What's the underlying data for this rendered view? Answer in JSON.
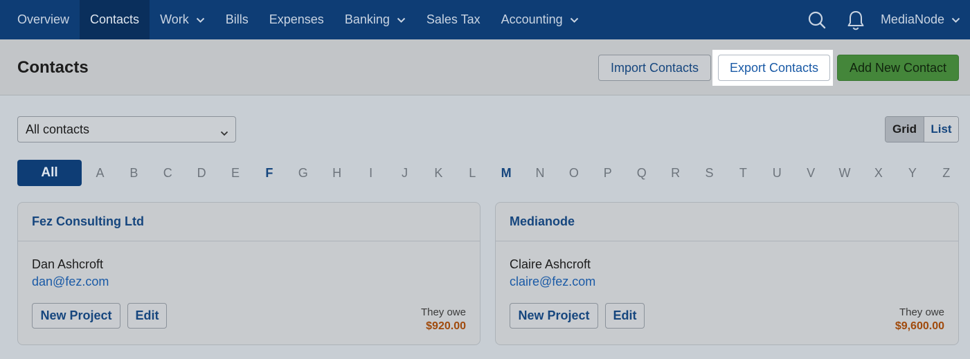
{
  "nav": {
    "items": [
      {
        "label": "Overview",
        "dropdown": false
      },
      {
        "label": "Contacts",
        "dropdown": false,
        "active": true
      },
      {
        "label": "Work",
        "dropdown": true
      },
      {
        "label": "Bills",
        "dropdown": false
      },
      {
        "label": "Expenses",
        "dropdown": false
      },
      {
        "label": "Banking",
        "dropdown": true
      },
      {
        "label": "Sales Tax",
        "dropdown": false
      },
      {
        "label": "Accounting",
        "dropdown": true
      }
    ],
    "account": "MediaNode",
    "icons": [
      "search-icon",
      "bell-icon"
    ]
  },
  "header": {
    "title": "Contacts",
    "import_label": "Import Contacts",
    "export_label": "Export Contacts",
    "add_label": "Add New Contact"
  },
  "filter": {
    "selected": "All contacts",
    "view_grid": "Grid",
    "view_list": "List",
    "view_active": "Grid"
  },
  "alphabet": {
    "all_label": "All",
    "letters": [
      "A",
      "B",
      "C",
      "D",
      "E",
      "F",
      "G",
      "H",
      "I",
      "J",
      "K",
      "L",
      "M",
      "N",
      "O",
      "P",
      "Q",
      "R",
      "S",
      "T",
      "U",
      "V",
      "W",
      "X",
      "Y",
      "Z"
    ],
    "with_contacts": [
      "F",
      "M"
    ]
  },
  "cards": [
    {
      "company": "Fez Consulting Ltd",
      "person": "Dan Ashcroft",
      "email": "dan@fez.com",
      "new_project": "New Project",
      "edit": "Edit",
      "owe_label": "They owe",
      "owe_value": "$920.00"
    },
    {
      "company": "Medianode",
      "person": "Claire Ashcroft",
      "email": "claire@fez.com",
      "new_project": "New Project",
      "edit": "Edit",
      "owe_label": "They owe",
      "owe_value": "$9,600.00"
    }
  ],
  "colors": {
    "nav_bg": "#0e3d75",
    "link": "#16467e",
    "add_button": "#44863a",
    "owe": "#a04a0c"
  }
}
